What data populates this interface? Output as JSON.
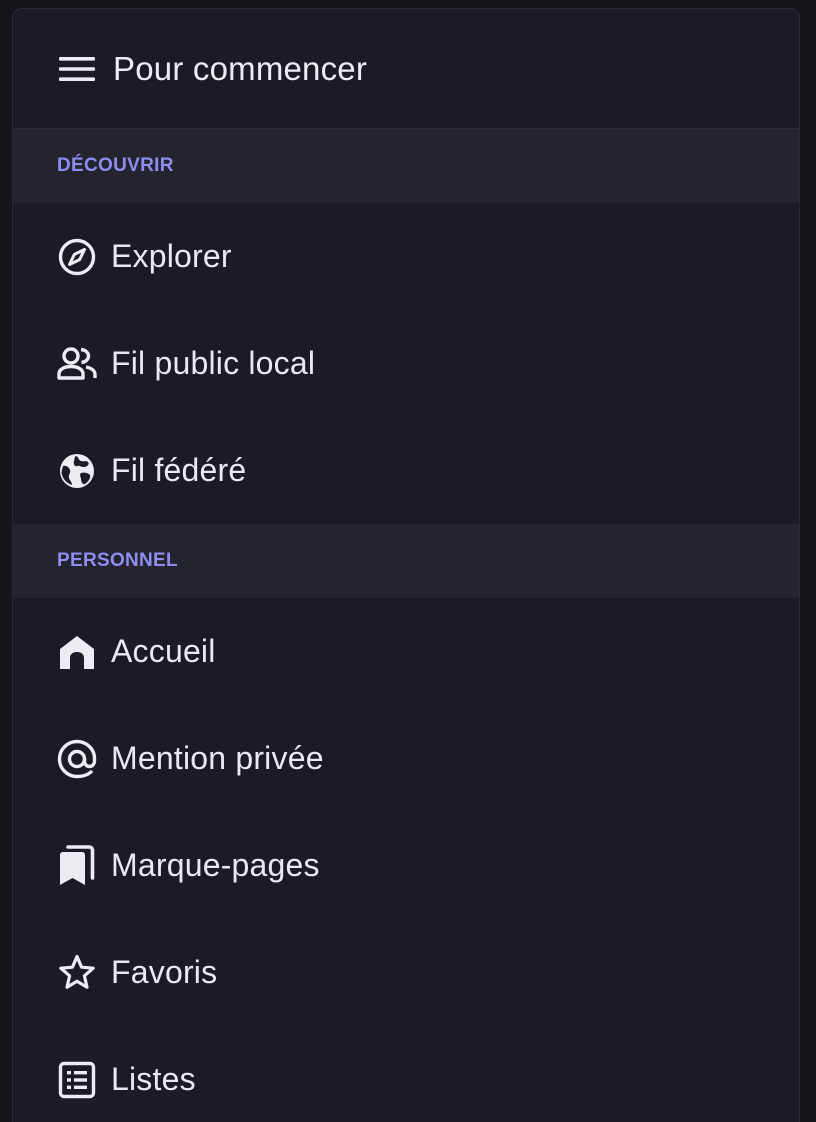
{
  "header": {
    "title": "Pour commencer",
    "icon": "menu-icon"
  },
  "sections": [
    {
      "title": "DÉCOUVRIR",
      "items": [
        {
          "label": "Explorer",
          "icon": "compass-icon"
        },
        {
          "label": "Fil public local",
          "icon": "people-icon"
        },
        {
          "label": "Fil fédéré",
          "icon": "globe-icon"
        }
      ]
    },
    {
      "title": "PERSONNEL",
      "items": [
        {
          "label": "Accueil",
          "icon": "home-icon"
        },
        {
          "label": "Mention privée",
          "icon": "at-sign-icon"
        },
        {
          "label": "Marque-pages",
          "icon": "bookmarks-icon"
        },
        {
          "label": "Favoris",
          "icon": "star-icon"
        },
        {
          "label": "Listes",
          "icon": "list-icon"
        }
      ]
    }
  ],
  "colors": {
    "background": "#1b1b25",
    "section_background": "#24242f",
    "section_text": "#8f8df0",
    "text": "#e9e9f1"
  }
}
